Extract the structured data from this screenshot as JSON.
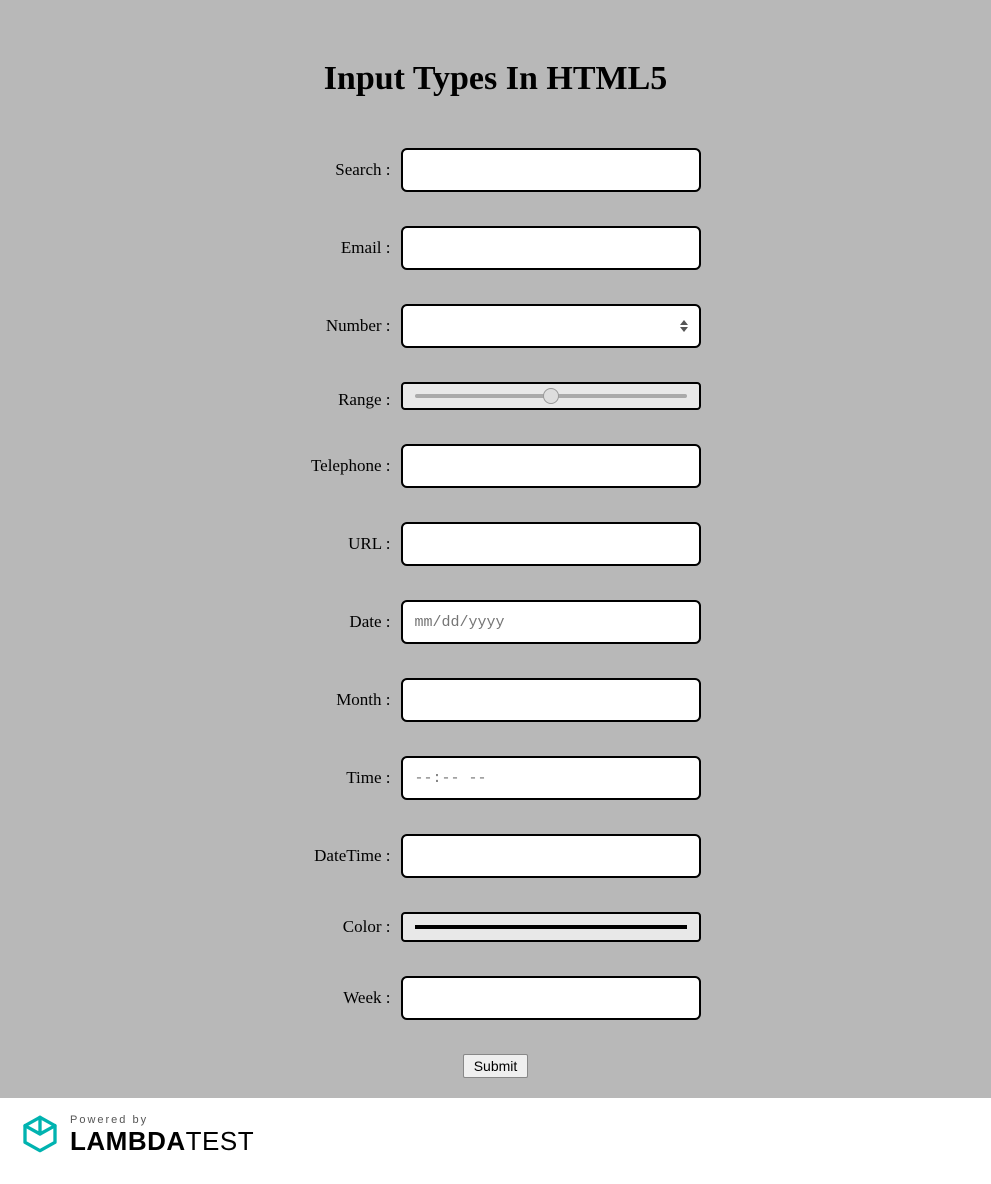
{
  "title": "Input Types In HTML5",
  "fields": {
    "search": {
      "label": "Search :",
      "value": ""
    },
    "email": {
      "label": "Email :",
      "value": ""
    },
    "number": {
      "label": "Number :",
      "value": ""
    },
    "range": {
      "label": "Range :",
      "value": 50
    },
    "telephone": {
      "label": "Telephone :",
      "value": ""
    },
    "url": {
      "label": "URL :",
      "value": ""
    },
    "date": {
      "label": "Date :",
      "placeholder": "mm/dd/yyyy",
      "value": ""
    },
    "month": {
      "label": "Month :",
      "value": ""
    },
    "time": {
      "label": "Time :",
      "placeholder": "--:-- --",
      "value": ""
    },
    "datetime": {
      "label": "DateTime :",
      "value": ""
    },
    "color": {
      "label": "Color :",
      "value": "#000000"
    },
    "week": {
      "label": "Week :",
      "value": ""
    }
  },
  "submit_label": "Submit",
  "footer": {
    "powered_by": "Powered by",
    "brand_bold": "LAMBDA",
    "brand_light": "TEST",
    "brand_color": "#00b3b0"
  }
}
